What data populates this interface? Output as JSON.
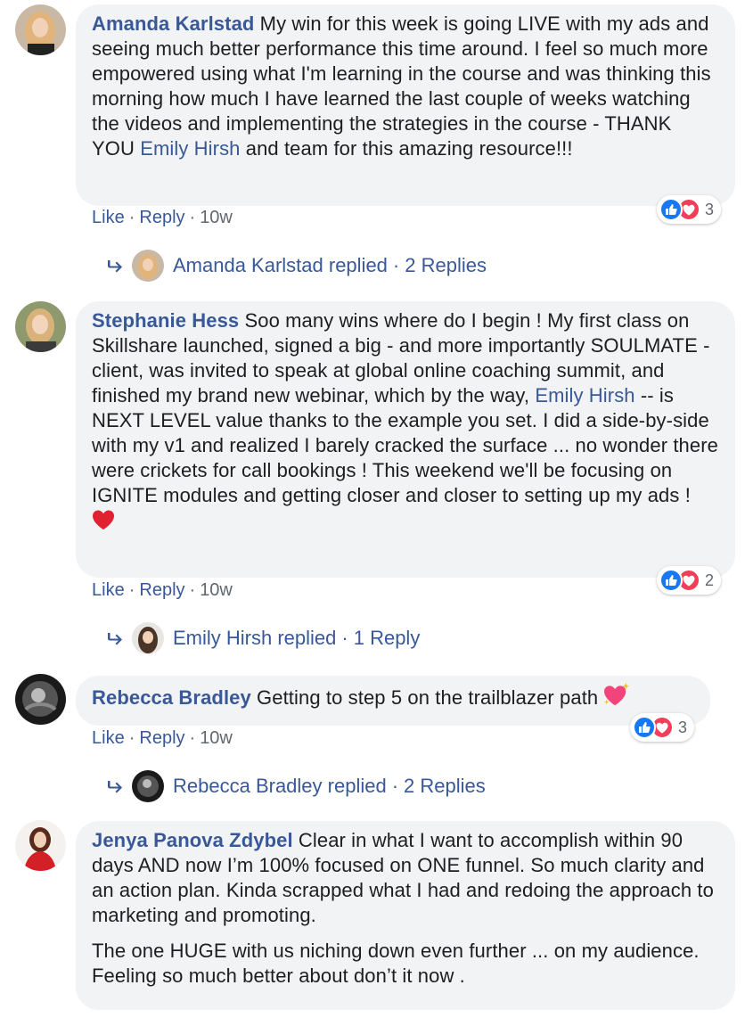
{
  "comments": [
    {
      "author": "Amanda Karlstad",
      "text_parts": [
        "My win for this week is going LIVE with my ads and seeing much better performance this time around. I feel so much more empowered using what I'm learning in the course and was thinking this morning how much I have learned the last couple of weeks watching the videos and implementing the strategies in the course - THANK YOU ",
        "Emily Hirsh",
        " and team for this amazing resource!!!"
      ],
      "like_label": "Like",
      "reply_label": "Reply",
      "time": "10w",
      "reaction_count": "3",
      "replied_by": "Amanda Karlstad replied",
      "replies_count": "2 Replies"
    },
    {
      "author": "Stephanie Hess",
      "text_parts": [
        "Soo many wins where do I begin ! My first class on Skillshare launched, signed a big - and more importantly SOULMATE - client, was invited to speak at global online coaching summit, and finished my brand new webinar, which by the way, ",
        "Emily Hirsh",
        " -- is NEXT LEVEL value thanks to the example you set. I did a side-by-side with my v1 and realized I barely cracked the surface ... no wonder there were crickets for call bookings ! This weekend we'll be focusing on IGNITE modules and getting closer and closer to setting up my ads ! "
      ],
      "like_label": "Like",
      "reply_label": "Reply",
      "time": "10w",
      "reaction_count": "2",
      "replied_by": "Emily Hirsh replied",
      "replies_count": "1 Reply"
    },
    {
      "author": "Rebecca Bradley",
      "text": "Getting to step 5 on the trailblazer path ",
      "like_label": "Like",
      "reply_label": "Reply",
      "time": "10w",
      "reaction_count": "3",
      "replied_by": "Rebecca Bradley replied",
      "replies_count": "2 Replies"
    },
    {
      "author": "Jenya Panova Zdybel",
      "text": "Clear in what I want to accomplish within 90 days AND now I’m 100% focused on ONE funnel. So much clarity and an action plan. Kinda scrapped what I had and redoing the approach to marketing and promoting.",
      "text2": "The one HUGE with us niching down even further ... on my audience. Feeling so much better about don’t it now ."
    }
  ],
  "separator": "·",
  "colors": {
    "link": "#385898",
    "bubble": "#f2f3f5",
    "like": "#1877f2",
    "love": "#f33e58"
  }
}
